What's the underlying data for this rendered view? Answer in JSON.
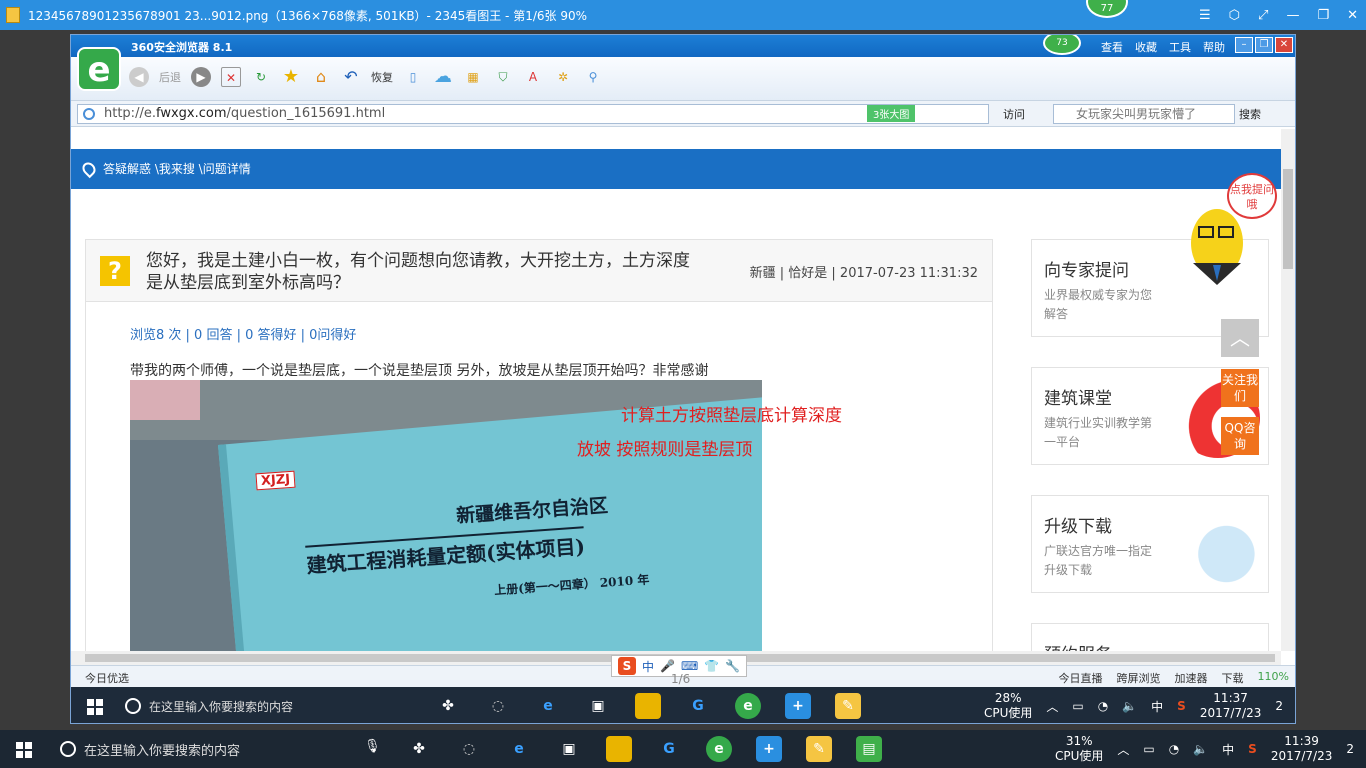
{
  "viewer": {
    "title": "12345678901235678901 23...9012.png（1366×768像素, 501KB）- 2345看图王 - 第1/6张 90%",
    "badge": "77",
    "controls": [
      "☰",
      "⬡",
      "⤢",
      "—",
      "❐",
      "✕"
    ],
    "pager": "1/6"
  },
  "browser": {
    "name": "360安全浏览器 8.1",
    "badge": "73",
    "menu": [
      "查看",
      "收藏",
      "工具",
      "帮助"
    ],
    "logo": "e",
    "toolbar": {
      "back": "后退",
      "restore": "恢复"
    },
    "url_prefix": "http://e.",
    "url_domain": "fwxgx.com",
    "url_path": "/question_1615691.html",
    "image_count": "3张大图",
    "visit": "访问",
    "search_placeholder": "女玩家尖叫男玩家懵了",
    "search_button": "搜索"
  },
  "page": {
    "breadcrumb": "答疑解惑 \\我来搜 \\问题详情",
    "question": {
      "icon": "?",
      "title": "您好，我是土建小白一枚，有个问题想向您请教，大开挖土方，土方深度是从垫层底到室外标高吗？",
      "meta": "新疆 | 恰好是 | 2017-07-23 11:31:32",
      "stats": "浏览8 次 | 0 回答 | 0 答得好 | 0问得好",
      "body": "带我的两个师傅，一个说是垫层底，一个说是垫层顶   另外，放坡是从垫层顶开始吗？非常感谢"
    },
    "photo": {
      "tag": "XJZJ",
      "line1": "新疆维吾尔自治区",
      "line2": "建筑工程消耗量定额(实体项目)",
      "line3": "上册(第一～四章）  2010 年",
      "anno1": "计算土方按照垫层底计算深度",
      "anno2": "放坡  按照规则是垫层顶"
    },
    "sidebar": [
      {
        "title": "向专家提问",
        "desc": "业界最权威专家为您解答"
      },
      {
        "title": "建筑课堂",
        "desc": "建筑行业实训教学第一平台"
      },
      {
        "title": "升级下载",
        "desc": "广联达官方唯一指定升级下载"
      },
      {
        "title": "预约服务",
        "desc": ""
      }
    ],
    "mascot_bubble": "点我提问哦",
    "float_follow": "关注我们",
    "float_qq": "QQ咨询"
  },
  "statusbar": {
    "left": "今日优选",
    "items": [
      "今日直播",
      "跨屏浏览",
      "加速器",
      "下载"
    ],
    "zoom": "110%"
  },
  "ime": {
    "logo": "S",
    "lang": "中"
  },
  "inner_taskbar": {
    "search": "在这里输入你要搜索的内容",
    "cpu": "28%",
    "cpu_label": "CPU使用",
    "lang": "中",
    "time": "11:37",
    "date": "2017/7/23",
    "notify": "2"
  },
  "taskbar": {
    "search": "在这里输入你要搜索的内容",
    "cpu": "31%",
    "cpu_label": "CPU使用",
    "lang": "中",
    "time": "11:39",
    "date": "2017/7/23",
    "notify": "2"
  }
}
